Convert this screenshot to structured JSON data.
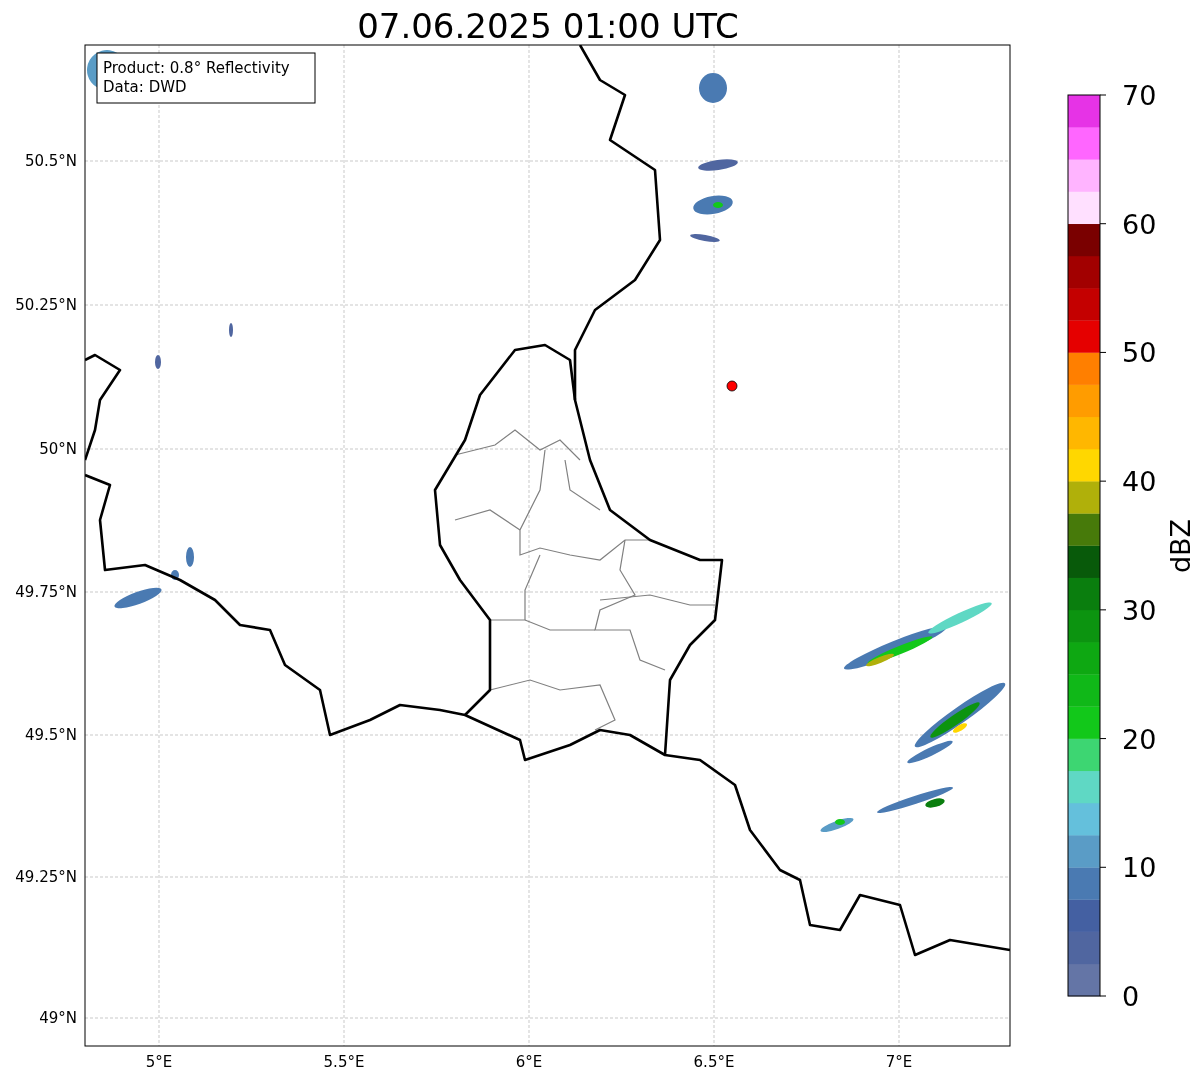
{
  "title": "07.06.2025 01:00 UTC",
  "info_box": [
    "Product: 0.8° Reflectivity",
    "Data: DWD"
  ],
  "map": {
    "xticks": [
      "5°E",
      "5.5°E",
      "6°E",
      "6.5°E",
      "7°E"
    ],
    "yticks": [
      "50.5°N",
      "50.25°N",
      "50°N",
      "49.75°N",
      "49.5°N",
      "49.25°N",
      "49°N"
    ]
  },
  "colorbar": {
    "label": "dBZ",
    "ticks": [
      "70",
      "60",
      "50",
      "40",
      "30",
      "20",
      "10",
      "0"
    ],
    "bands": [
      {
        "color": "#6475a6"
      },
      {
        "color": "#5066a0"
      },
      {
        "color": "#4460a2"
      },
      {
        "color": "#4a7ab2"
      },
      {
        "color": "#5a9cc6"
      },
      {
        "color": "#64c0dc"
      },
      {
        "color": "#5fd8c4"
      },
      {
        "color": "#3dd672"
      },
      {
        "color": "#12c81a"
      },
      {
        "color": "#10b818"
      },
      {
        "color": "#0ea812"
      },
      {
        "color": "#0c9410"
      },
      {
        "color": "#0a7e0e"
      },
      {
        "color": "#085a0a"
      },
      {
        "color": "#477a0a"
      },
      {
        "color": "#b0b00a"
      },
      {
        "color": "#ffd700"
      },
      {
        "color": "#ffb700"
      },
      {
        "color": "#ff9c00"
      },
      {
        "color": "#ff7f00"
      },
      {
        "color": "#e50000"
      },
      {
        "color": "#c40000"
      },
      {
        "color": "#a20000"
      },
      {
        "color": "#7a0000"
      },
      {
        "color": "#ffe0ff"
      },
      {
        "color": "#ffb4ff"
      },
      {
        "color": "#ff66ff"
      },
      {
        "color": "#e633e6"
      }
    ]
  }
}
